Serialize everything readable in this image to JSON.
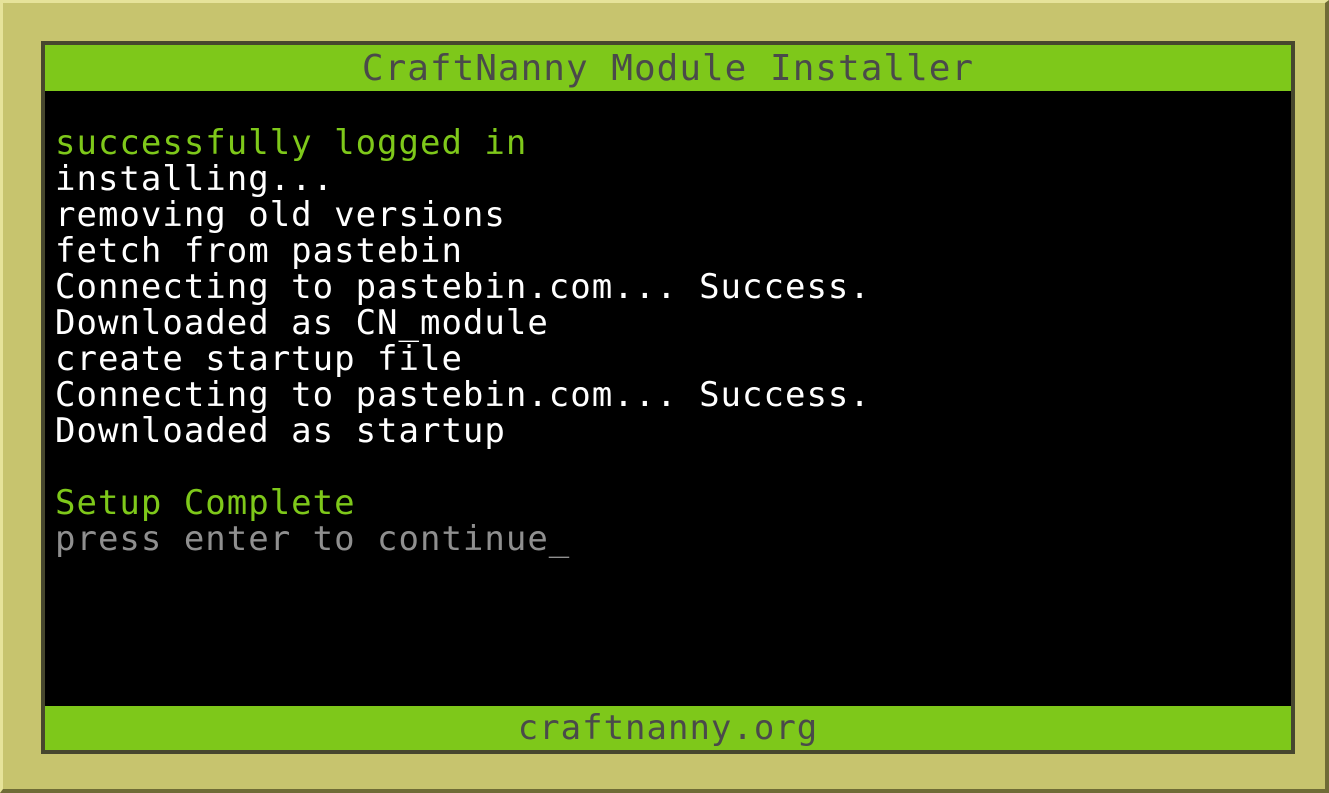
{
  "window": {
    "title": "CraftNanny Module Installer"
  },
  "terminal": {
    "lines": [
      {
        "text": "successfully logged in",
        "color": "green"
      },
      {
        "text": "installing...",
        "color": "white"
      },
      {
        "text": "removing old versions",
        "color": "white"
      },
      {
        "text": "fetch from pastebin",
        "color": "white"
      },
      {
        "text": "Connecting to pastebin.com... Success.",
        "color": "white"
      },
      {
        "text": "Downloaded as CN_module",
        "color": "white"
      },
      {
        "text": "create startup file",
        "color": "white"
      },
      {
        "text": "Connecting to pastebin.com... Success.",
        "color": "white"
      },
      {
        "text": "Downloaded as startup",
        "color": "white"
      },
      {
        "text": "",
        "color": "blank"
      },
      {
        "text": "Setup Complete",
        "color": "green"
      },
      {
        "text": "press enter to continue_",
        "color": "gray"
      }
    ]
  },
  "footer": {
    "text": "craftnanny.org"
  },
  "colors": {
    "accent_green": "#7ec81a",
    "bezel": "#c7c46e",
    "screen_bg": "#000000",
    "bar_text": "#4a4a4a",
    "prompt_gray": "#8f8f8f"
  }
}
